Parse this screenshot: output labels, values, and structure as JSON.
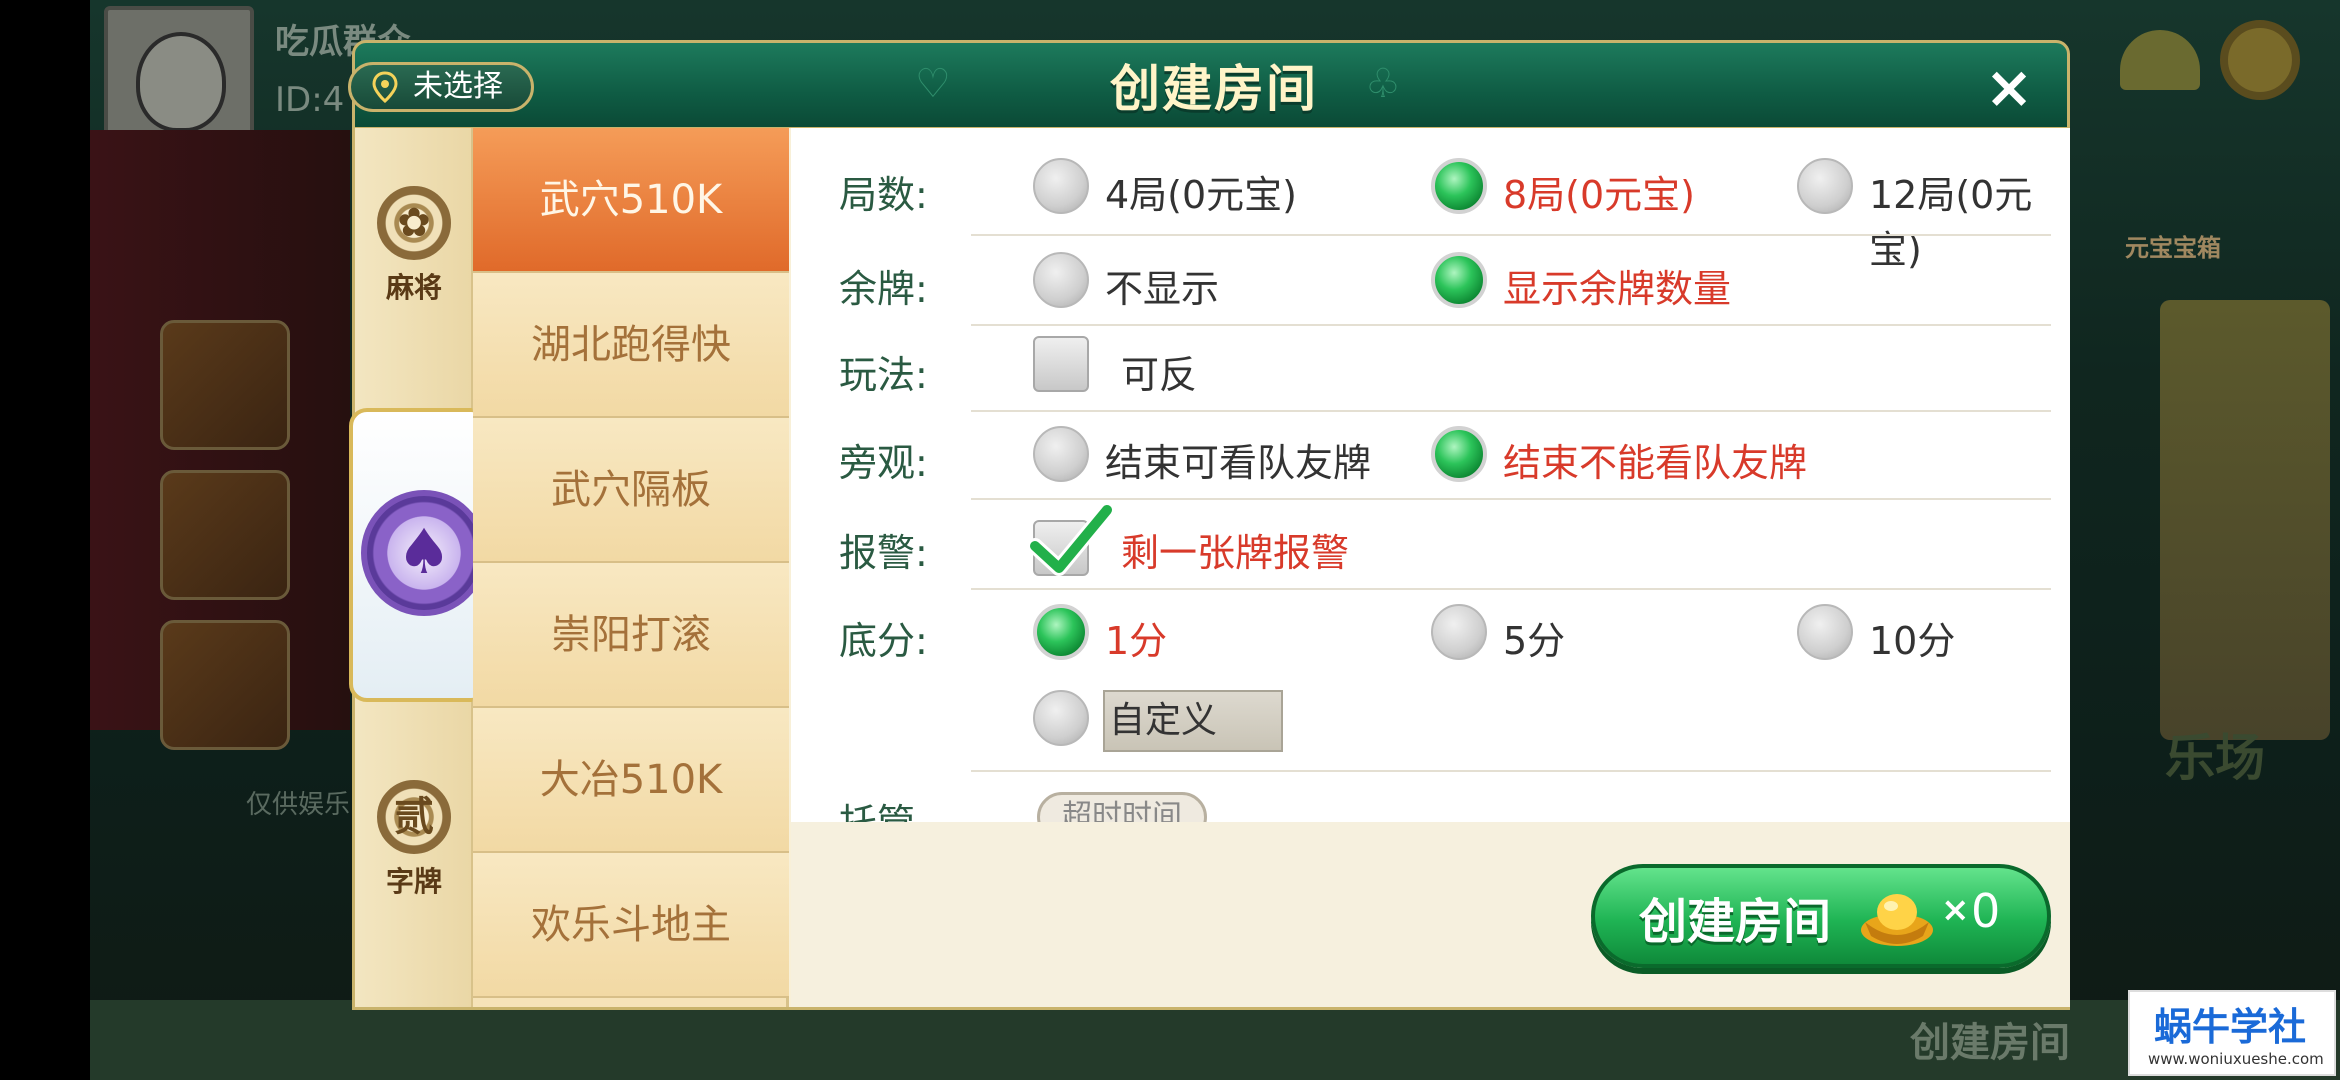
{
  "background": {
    "player_name": "吃瓜群众",
    "player_id": "ID:4",
    "treasure_label": "元宝宝箱",
    "notice_text": "仅供娱乐",
    "fun_label": "乐场",
    "create_room_label": "创建房间"
  },
  "modal": {
    "title": "创建房间",
    "location": "未选择",
    "close_label": "×"
  },
  "categories": [
    {
      "label": "麻将",
      "emblem": "✿"
    },
    {
      "label": "",
      "emblem": "♠"
    },
    {
      "label": "字牌",
      "emblem": "贰"
    }
  ],
  "games": [
    "武穴510K",
    "湖北跑得快",
    "武穴隔板",
    "崇阳打滚",
    "大冶510K",
    "欢乐斗地主"
  ],
  "options": {
    "rounds": {
      "label": "局数:",
      "choices": [
        "4局(0元宝)",
        "8局(0元宝)",
        "12局(0元宝)"
      ],
      "selected": 1
    },
    "remaining": {
      "label": "余牌:",
      "choices": [
        "不显示",
        "显示余牌数量"
      ],
      "selected": 1
    },
    "play": {
      "label": "玩法:",
      "checkbox": "可反",
      "checked": false
    },
    "spectate": {
      "label": "旁观:",
      "choices": [
        "结束可看队友牌",
        "结束不能看队友牌"
      ],
      "selected": 1
    },
    "alarm": {
      "label": "报警:",
      "checkbox": "剩一张牌报警",
      "checked": true
    },
    "base_score": {
      "label": "底分:",
      "choices": [
        "1分",
        "5分",
        "10分"
      ],
      "selected": 0,
      "custom_choice": "自定义"
    },
    "hosting": {
      "label": "托管",
      "button": "超时时间"
    }
  },
  "footer": {
    "create_label": "创建房间",
    "multiplier": "×",
    "cost": "0"
  },
  "watermark": {
    "name": "蜗牛学社",
    "url": "www.woniuxueshe.com"
  },
  "colors": {
    "header_green": "#0f5c44",
    "accent_gold": "#c9b36b",
    "selected_red": "#d83a2a",
    "active_tab_orange": "#e06a2a",
    "button_green": "#1fb454"
  }
}
